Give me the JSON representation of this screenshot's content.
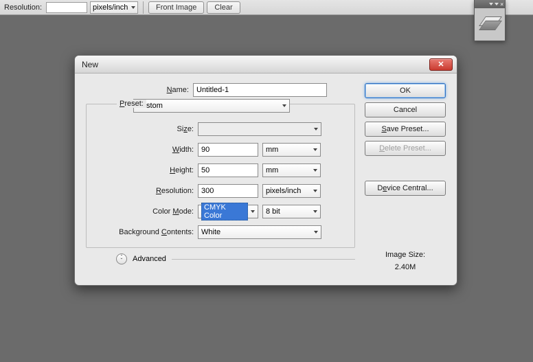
{
  "toolbar": {
    "resolution_label": "Resolution:",
    "resolution_value": "",
    "resolution_unit": "pixels/inch",
    "front_image_btn": "Front Image",
    "clear_btn": "Clear"
  },
  "dialog": {
    "title": "New",
    "name_label": "Name:",
    "name_value": "Untitled-1",
    "preset_label": "Preset:",
    "preset_value": "Custom",
    "size_label": "Size:",
    "size_value": "",
    "width_label": "Width:",
    "width_value": "90",
    "width_unit": "mm",
    "height_label": "Height:",
    "height_value": "50",
    "height_unit": "mm",
    "resolution_label": "Resolution:",
    "resolution_value": "300",
    "resolution_unit": "pixels/inch",
    "color_mode_label": "Color Mode:",
    "color_mode_value": "CMYK Color",
    "color_depth_value": "8 bit",
    "bg_label": "Background Contents:",
    "bg_value": "White",
    "advanced_label": "Advanced",
    "image_size_label": "Image Size:",
    "image_size_value": "2.40M",
    "buttons": {
      "ok": "OK",
      "cancel": "Cancel",
      "save_preset": "Save Preset...",
      "delete_preset": "Delete Preset...",
      "device_central": "Device Central..."
    }
  }
}
